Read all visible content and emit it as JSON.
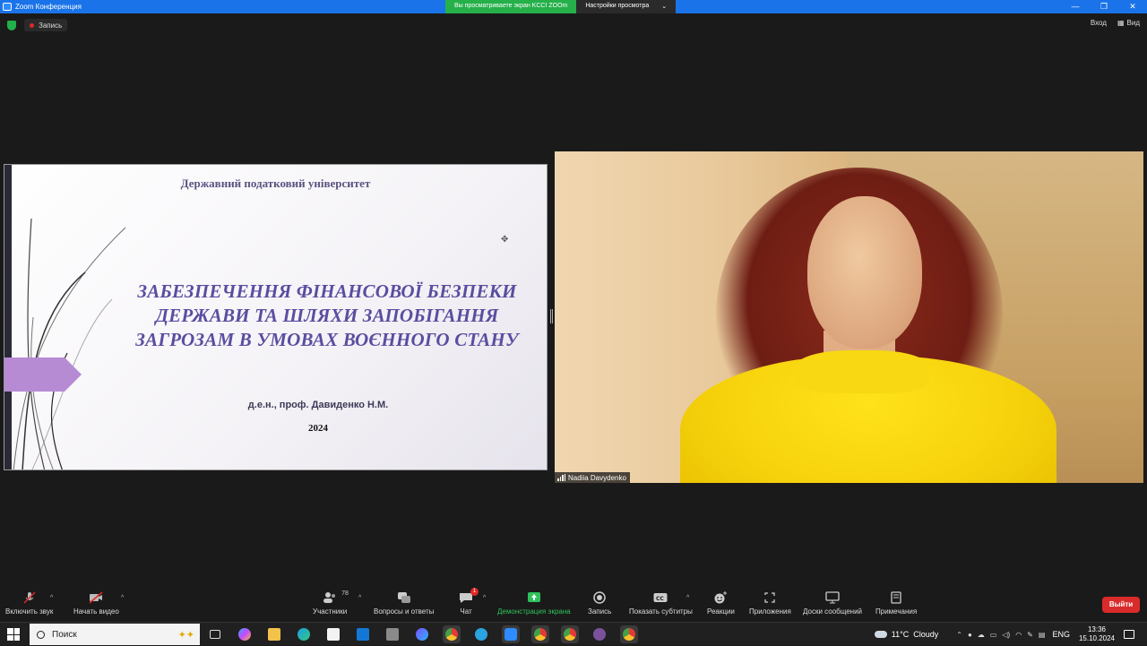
{
  "window": {
    "title": "Zoom Конференция",
    "share_banner": "Вы просматриваете экран KCCI ZOOm",
    "view_settings": "Настройки просмотра",
    "controls": [
      "—",
      "❐",
      "✕"
    ]
  },
  "topbar": {
    "recording_label": "Запись",
    "enter_label": "Вход",
    "view_label": "Вид"
  },
  "slide": {
    "university": "Державний податковий університет",
    "title": "ЗАБЕЗПЕЧЕННЯ ФІНАНСОВОЇ БЕЗПЕКИ ДЕРЖАВИ ТА ШЛЯХИ ЗАПОБІГАННЯ ЗАГРОЗАМ В УМОВАХ ВОЄННОГО СТАНУ",
    "author": "д.е.н., проф. Давиденко Н.М.",
    "year": "2024",
    "accent_color": "#b78bd4",
    "title_color": "#5a4da0"
  },
  "participant": {
    "name": "Nadiia Davydenko"
  },
  "toolbar": {
    "audio_label": "Включить звук",
    "video_label": "Начать видео",
    "participants_label": "Участники",
    "participants_count": "78",
    "qa_label": "Вопросы и ответы",
    "chat_label": "Чат",
    "chat_badge": "1",
    "share_label": "Демонстрация экрана",
    "record_label": "Запись",
    "captions_label": "Показать субтитры",
    "reactions_label": "Реакции",
    "apps_label": "Приложения",
    "whiteboards_label": "Доски сообщений",
    "notes_label": "Примечания",
    "exit_label": "Выйти",
    "share_color": "#2fc25b",
    "exit_color": "#d92b2b"
  },
  "taskbar": {
    "search_placeholder": "Поиск",
    "weather_temp": "11°C",
    "weather_desc": "Cloudy",
    "lang": "ENG",
    "time": "13:36",
    "date": "15.10.2024",
    "apps": [
      "task-view-icon",
      "copilot-icon",
      "file-explorer-icon",
      "edge-icon",
      "store-icon",
      "mail-icon",
      "calculator-icon",
      "media-icon",
      "chrome-icon",
      "telegram-icon",
      "zoom-icon",
      "chrome-icon",
      "chrome-icon",
      "viber-icon",
      "chrome-icon"
    ]
  }
}
